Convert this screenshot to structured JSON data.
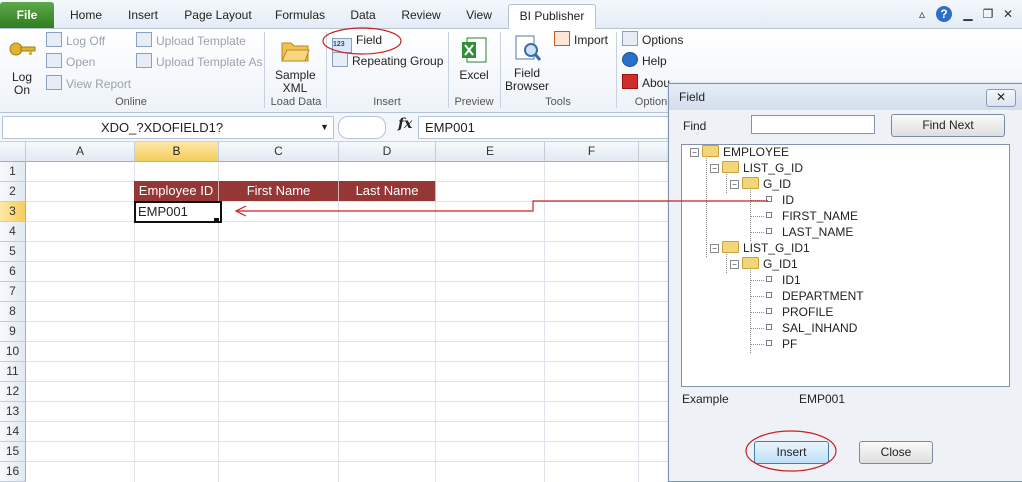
{
  "ribbon_tabs": {
    "file": "File",
    "home": "Home",
    "insert": "Insert",
    "page_layout": "Page Layout",
    "formulas": "Formulas",
    "data": "Data",
    "review": "Review",
    "view": "View",
    "bi_publisher": "BI Publisher"
  },
  "ribbon": {
    "online": {
      "log_on": "Log On",
      "log_off": "Log Off",
      "open": "Open",
      "view_report": "View Report",
      "upload_template": "Upload Template",
      "upload_template_as": "Upload Template As",
      "label": "Online"
    },
    "load_data": {
      "sample_xml": "Sample XML",
      "label": "Load Data"
    },
    "insert": {
      "field": "Field",
      "repeating_group": "Repeating Group",
      "label": "Insert"
    },
    "preview": {
      "excel": "Excel",
      "label": "Preview"
    },
    "tools": {
      "field_browser": "Field Browser",
      "import": "Import",
      "label": "Tools"
    },
    "options": {
      "options": "Options",
      "help": "Help",
      "about": "Abou",
      "label": "Option"
    }
  },
  "formula_bar": {
    "name_box": "XDO_?XDOFIELD1?",
    "fx": "fx",
    "formula": "EMP001"
  },
  "sheet": {
    "columns": [
      "A",
      "B",
      "C",
      "D",
      "E",
      "F"
    ],
    "rows": [
      "1",
      "2",
      "3",
      "4",
      "5",
      "6",
      "7",
      "8",
      "9",
      "10",
      "11",
      "12",
      "13",
      "14",
      "15",
      "16"
    ],
    "header_cells": [
      "Employee ID",
      "First Name",
      "Last Name"
    ],
    "active_cell_value": "EMP001"
  },
  "dialog": {
    "title": "Field",
    "close_glyph": "✕",
    "find_label": "Find",
    "find_value": "",
    "find_next": "Find Next",
    "tree": {
      "root": "EMPLOYEE",
      "list1": "LIST_G_ID",
      "group1": "G_ID",
      "group1_fields": [
        "ID",
        "FIRST_NAME",
        "LAST_NAME"
      ],
      "list2": "LIST_G_ID1",
      "group2": "G_ID1",
      "group2_fields": [
        "ID1",
        "DEPARTMENT",
        "PROFILE",
        "SAL_INHAND",
        "PF"
      ]
    },
    "example_label": "Example",
    "example_value": "EMP001",
    "insert_button": "Insert",
    "close_button": "Close"
  },
  "colors": {
    "header_fill": "#953735",
    "annotation": "#cc1f1f",
    "file_tab": "#3d8a2c"
  }
}
